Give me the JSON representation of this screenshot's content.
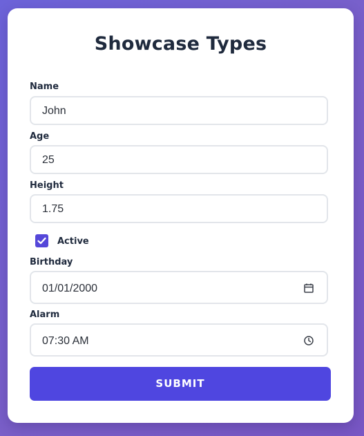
{
  "form": {
    "title": "Showcase Types",
    "name": {
      "label": "Name",
      "value": "John"
    },
    "age": {
      "label": "Age",
      "value": "25"
    },
    "height": {
      "label": "Height",
      "value": "1.75"
    },
    "active": {
      "label": "Active",
      "checked": true
    },
    "birthday": {
      "label": "Birthday",
      "value": "01/01/2000",
      "icon": "calendar-icon"
    },
    "alarm": {
      "label": "Alarm",
      "value": "07:30 AM",
      "icon": "clock-icon"
    },
    "submit_label": "SUBMIT"
  },
  "colors": {
    "accent": "#4f46e0",
    "background_start": "#6c63d9",
    "background_end": "#7857c4",
    "text": "#1f2a3d",
    "field_border": "#e2e5ea"
  }
}
